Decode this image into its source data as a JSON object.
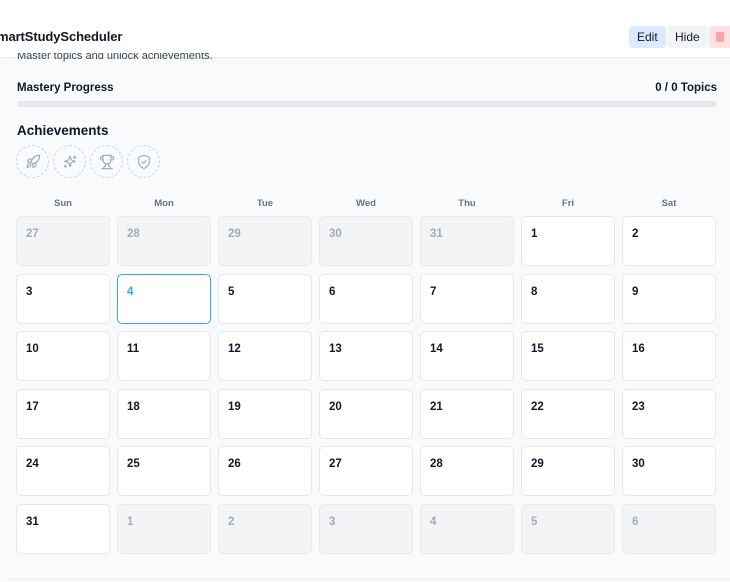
{
  "app": {
    "title": "martStudyScheduler",
    "buttons": {
      "edit": "Edit",
      "hide": "Hide"
    }
  },
  "summary": {
    "subtitle": "Master topics and unlock achievements.",
    "mastery_label": "Mastery Progress",
    "mastery_count": "0 / 0 Topics",
    "progress_fraction": 0
  },
  "achievements": {
    "title": "Achievements",
    "icons": [
      "rocket-icon",
      "sparkle-icon",
      "trophy-icon",
      "shield-check-icon"
    ]
  },
  "calendar": {
    "weekdays": [
      "Sun",
      "Mon",
      "Tue",
      "Wed",
      "Thu",
      "Fri",
      "Sat"
    ],
    "weeks": [
      [
        {
          "d": "27",
          "other": true
        },
        {
          "d": "28",
          "other": true
        },
        {
          "d": "29",
          "other": true
        },
        {
          "d": "30",
          "other": true
        },
        {
          "d": "31",
          "other": true
        },
        {
          "d": "1"
        },
        {
          "d": "2"
        }
      ],
      [
        {
          "d": "3"
        },
        {
          "d": "4",
          "today": true
        },
        {
          "d": "5"
        },
        {
          "d": "6"
        },
        {
          "d": "7"
        },
        {
          "d": "8"
        },
        {
          "d": "9"
        }
      ],
      [
        {
          "d": "10"
        },
        {
          "d": "11"
        },
        {
          "d": "12"
        },
        {
          "d": "13"
        },
        {
          "d": "14"
        },
        {
          "d": "15"
        },
        {
          "d": "16"
        }
      ],
      [
        {
          "d": "17"
        },
        {
          "d": "18"
        },
        {
          "d": "19"
        },
        {
          "d": "20"
        },
        {
          "d": "21"
        },
        {
          "d": "22"
        },
        {
          "d": "23"
        }
      ],
      [
        {
          "d": "24"
        },
        {
          "d": "25"
        },
        {
          "d": "26"
        },
        {
          "d": "27"
        },
        {
          "d": "28"
        },
        {
          "d": "29"
        },
        {
          "d": "30"
        }
      ],
      [
        {
          "d": "31"
        },
        {
          "d": "1",
          "other": true
        },
        {
          "d": "2",
          "other": true
        },
        {
          "d": "3",
          "other": true
        },
        {
          "d": "4",
          "other": true
        },
        {
          "d": "5",
          "other": true
        },
        {
          "d": "6",
          "other": true
        }
      ]
    ]
  },
  "colors": {
    "accent": "#38a9dd",
    "edit_bg": "#dbeafe",
    "delete_bg": "#fee2e2"
  }
}
